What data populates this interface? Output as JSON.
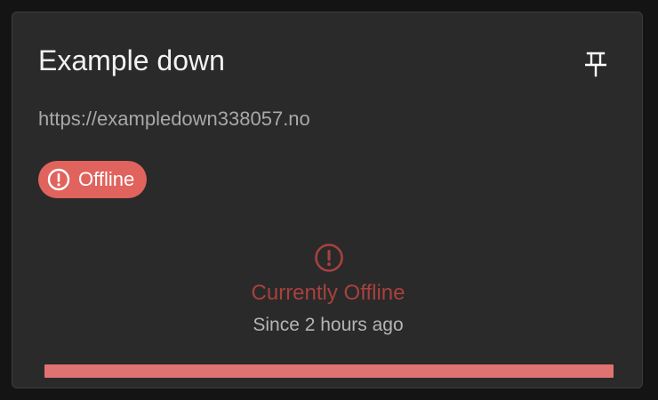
{
  "card": {
    "title": "Example down",
    "url": "https://exampledown338057.no",
    "pin_icon": "pin-icon"
  },
  "badge": {
    "label": "Offline",
    "icon": "alert-circle-icon",
    "color": "#e0635d"
  },
  "status": {
    "title": "Currently Offline",
    "since": "Since 2 hours ago",
    "icon": "alert-circle-icon",
    "color": "#a8413d"
  },
  "uptime_bar": {
    "fill_fraction": 1.0,
    "color": "#e07272"
  }
}
